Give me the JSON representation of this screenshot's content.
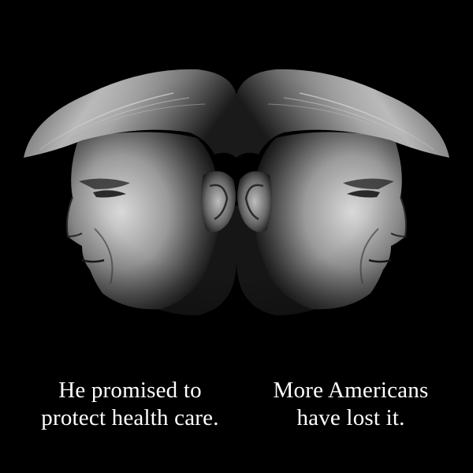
{
  "colors": {
    "background": "#000000",
    "text": "#ffffff"
  },
  "image": {
    "icon": "mirrored-profile-portrait"
  },
  "captions": {
    "left": {
      "line1": "He promised to",
      "line2": "protect health care."
    },
    "right": {
      "line1": "More Americans",
      "line2": "have lost it."
    }
  }
}
